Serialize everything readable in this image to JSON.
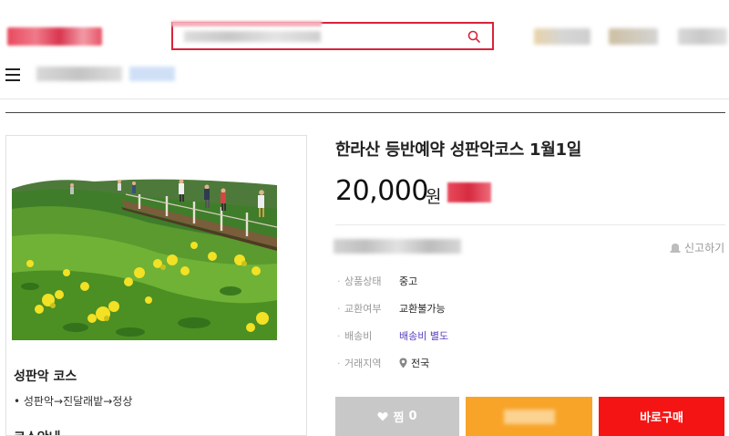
{
  "header": {
    "search": {
      "placeholder": ""
    }
  },
  "product": {
    "title": "한라산 등반예약 성판악코스 1월1일",
    "price": "20,000",
    "price_unit": "원",
    "report_label": "신고하기",
    "info": [
      {
        "label": "상품상태",
        "value": "중고"
      },
      {
        "label": "교환여부",
        "value": "교환불가능"
      },
      {
        "label": "배송비",
        "value": "배송비 별도"
      },
      {
        "label": "거래지역",
        "value": "전국"
      }
    ]
  },
  "description": {
    "heading": "성판악 코스",
    "route": "• 성판악→진달래밭→정상",
    "more_heading": "코스안내"
  },
  "actions": {
    "like_label": "찜",
    "like_count": "0",
    "buy_label": "바로구매"
  },
  "colors": {
    "accent_red": "#d9233a",
    "buy_button": "#f51414",
    "chat_button": "#f8a429",
    "like_button": "#c8c8c8",
    "link_purple": "#5b3fbf"
  },
  "icons": [
    "search-icon",
    "menu-icon",
    "siren-icon",
    "location-pin-icon",
    "heart-icon"
  ]
}
